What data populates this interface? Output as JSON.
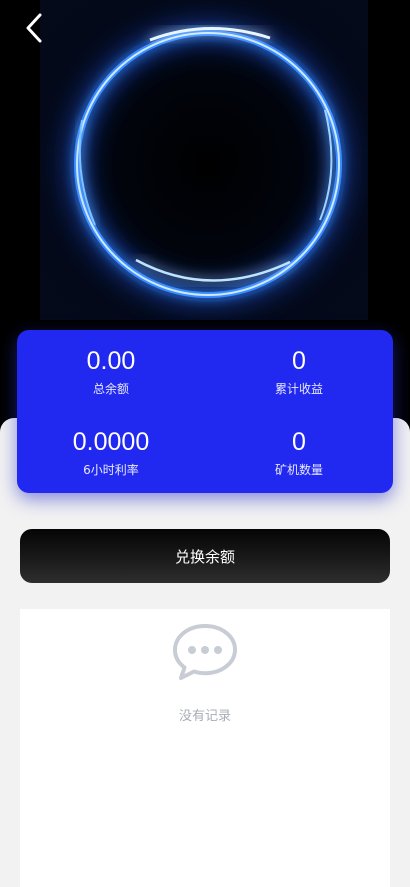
{
  "header": {
    "back_icon": "chevron-left-icon"
  },
  "hero": {
    "image": "glowing-blue-ring",
    "ring_color": "#3a8dff",
    "glow_color": "#9fd4ff"
  },
  "stats": {
    "card_color": "#2128f0",
    "items": [
      {
        "value": "0.00",
        "label": "总余额"
      },
      {
        "value": "0",
        "label": "累计收益"
      },
      {
        "value": "0.0000",
        "label": "6小时利率"
      },
      {
        "value": "0",
        "label": "矿机数量"
      }
    ]
  },
  "actions": {
    "exchange_label": "兑换余额"
  },
  "records": {
    "empty_icon": "chat-bubble-icon",
    "empty_text": "没有记录"
  }
}
